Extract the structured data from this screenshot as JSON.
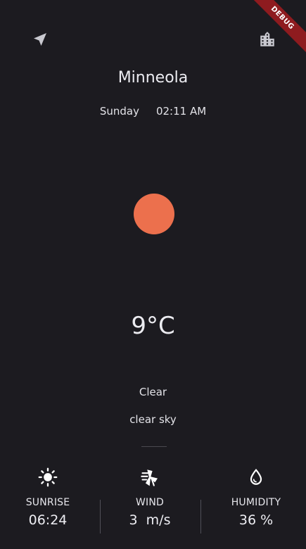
{
  "header": {
    "location_icon": "navigation-arrow-icon",
    "city_icon": "city-buildings-icon",
    "debug_banner": "DEBUG"
  },
  "location": {
    "city": "Minneola",
    "day": "Sunday",
    "time": "02:11 AM"
  },
  "weather": {
    "icon": "sun-ball",
    "icon_color": "#ec704d",
    "temperature": "9°C",
    "main": "Clear",
    "description": "clear sky"
  },
  "stats": {
    "sunrise": {
      "icon": "sun-icon",
      "label": "SUNRISE",
      "value": "06:24"
    },
    "wind": {
      "icon": "wind-turbine-icon",
      "label": "WIND",
      "value": "3  m/s"
    },
    "humidity": {
      "icon": "water-drop-icon",
      "label": "HUMIDITY",
      "value": "36 %"
    }
  },
  "colors": {
    "background": "#1c1b20",
    "text": "#ececf1",
    "debug_banner": "#8e1b1f"
  }
}
